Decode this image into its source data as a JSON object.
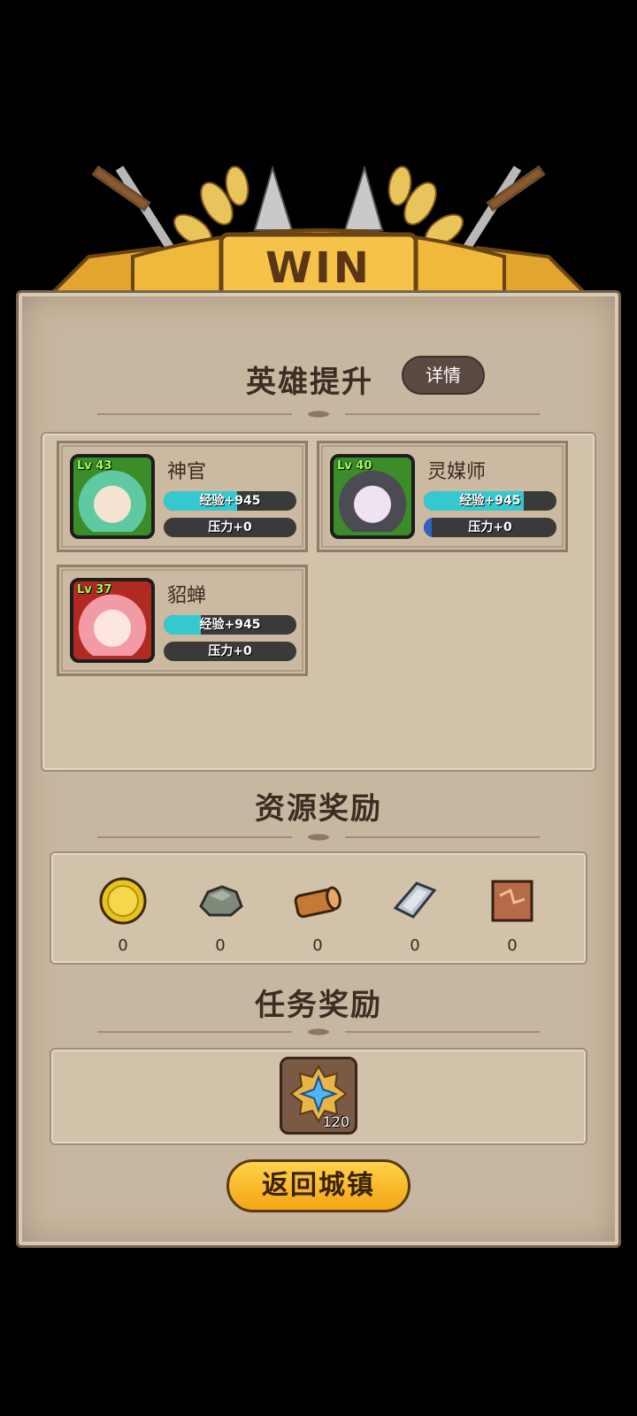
{
  "banner": {
    "title": "WIN"
  },
  "hero_section": {
    "title": "英雄提升",
    "detail_button": "详情",
    "heroes": [
      {
        "name": "神官",
        "level": "Lv 43",
        "exp_label": "经验+945",
        "exp_fill": 0.55,
        "stress_label": "压力+0",
        "stress_fill": 0.0,
        "frame_color": "#3c8d2a"
      },
      {
        "name": "灵媒师",
        "level": "Lv 40",
        "exp_label": "经验+945",
        "exp_fill": 0.75,
        "stress_label": "压力+0",
        "stress_fill": 0.06,
        "frame_color": "#3c8d2a"
      },
      {
        "name": "貂蝉",
        "level": "Lv 37",
        "exp_label": "经验+945",
        "exp_fill": 0.28,
        "stress_label": "压力+0",
        "stress_fill": 0.0,
        "frame_color": "#b02a22"
      }
    ]
  },
  "resource_section": {
    "title": "资源奖励",
    "items": [
      {
        "icon": "gold-coin-icon",
        "value": "0"
      },
      {
        "icon": "stone-icon",
        "value": "0"
      },
      {
        "icon": "wood-log-icon",
        "value": "0"
      },
      {
        "icon": "iron-ingot-icon",
        "value": "0"
      },
      {
        "icon": "leather-icon",
        "value": "0"
      }
    ]
  },
  "quest_section": {
    "title": "任务奖励",
    "reward": {
      "icon": "star-medal-icon",
      "value": "120"
    }
  },
  "return_button": "返回城镇",
  "colors": {
    "exp": "#35c9cf",
    "stress": "#2f62c6",
    "accent": "#f2a514",
    "parchment": "#c8b7a0"
  }
}
